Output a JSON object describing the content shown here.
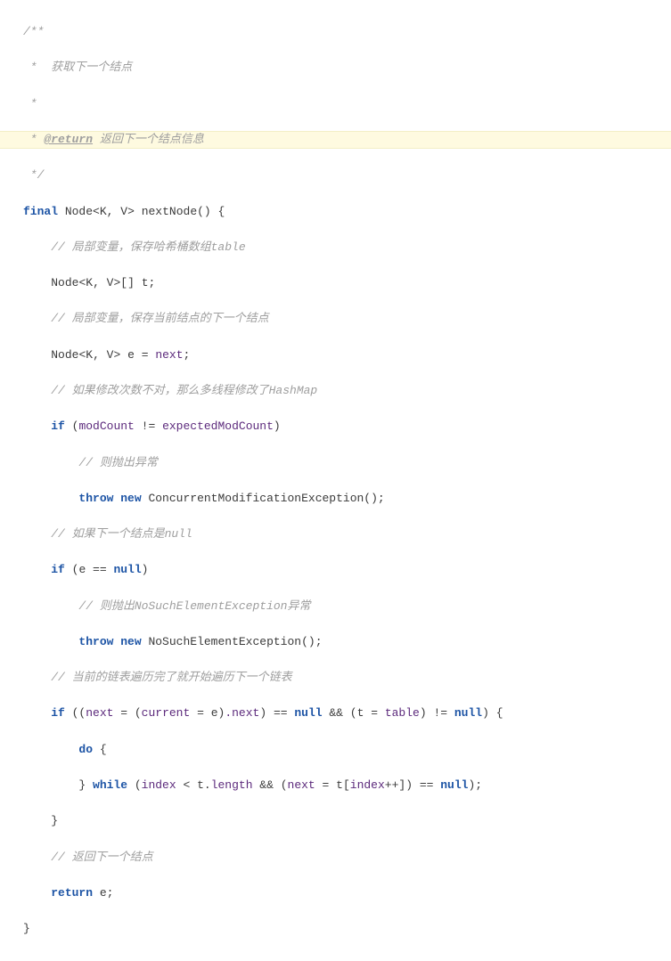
{
  "code": {
    "doc": {
      "open": "/**",
      "l1": " *  获取下一个结点",
      "l2": " *",
      "l3_prefix": " * ",
      "l3_tag": "@return",
      "l3_rest": " 返回下一个结点信息",
      "close": " */"
    },
    "sig": {
      "kw_final": "final",
      "type_node": "Node",
      "lt": "<",
      "kparam": "K",
      "comma": ", ",
      "vparam": "V",
      "gt": ">",
      "fn_name": " nextNode",
      "parens": "()",
      "brace": " {"
    },
    "l_localvar_t_cmt": "// 局部变量，保存哈希桶数组table",
    "l_decl_t": {
      "type_node": "Node",
      "lt": "<",
      "kparam": "K",
      "comma": ", ",
      "vparam": "V",
      "gt": ">",
      "arr": "[]",
      "var": " t",
      "semi": ";"
    },
    "l_localvar_e_cmt": "// 局部变量，保存当前结点的下一个结点",
    "l_decl_e": {
      "type_node": "Node",
      "lt": "<",
      "kparam": "K",
      "comma": ", ",
      "vparam": "V",
      "gt": ">",
      "var": " e ",
      "eq": "=",
      "rhs": " next",
      "semi": ";"
    },
    "l_modcount_cmt": "// 如果修改次数不对，那么多线程修改了HashMap",
    "l_if_modcount": {
      "kw_if": "if",
      "open": " (",
      "lhs": "modCount",
      "op": " != ",
      "rhs": "expectedModCount",
      "close": ")"
    },
    "l_throw_cme_cmt": "// 则抛出异常",
    "l_throw_cme": {
      "kw_throw": "throw",
      "kw_new": " new",
      "cls": " ConcurrentModificationException",
      "tail": "();"
    },
    "l_next_null_cmt": "// 如果下一个结点是null",
    "l_if_e_null": {
      "kw_if": "if",
      "open": " (",
      "lhs": "e ",
      "eq": "==",
      "rhs": " null",
      "close": ")"
    },
    "l_throw_nse_cmt": "// 则抛出NoSuchElementException异常",
    "l_throw_nse": {
      "kw_throw": "throw",
      "kw_new": " new",
      "cls": " NoSuchElementException",
      "tail": "();"
    },
    "l_curlist_cmt": "// 当前的链表遍历完了就开始遍历下一个链表",
    "l_if_next": {
      "kw_if": "if",
      "open1": " ((",
      "next": "next",
      "eq1": " = ",
      "open2": "(",
      "current": "current",
      "eq2": " = ",
      "e": "e",
      "close2": ")",
      "dotnext": ".next",
      "close1": ")",
      "eqeq": " == ",
      "null1": "null",
      "and1": " && ",
      "open3": "(",
      "t": "t ",
      "eq3": "= ",
      "table": "table",
      "close3": ")",
      "neq": " != ",
      "null2": "null",
      "close_outer": ")",
      "brace": " {"
    },
    "l_do": {
      "kw_do": "do",
      "brace": " {"
    },
    "l_while": {
      "close_brace": "} ",
      "kw_while": "while",
      "open": " (",
      "index1": "index",
      "lt": " < ",
      "tdot": "t.",
      "length": "length",
      "and": " && ",
      "open2": "(",
      "next": "next",
      "eq": " = ",
      "t": "t",
      "br_open": "[",
      "index2": "index",
      "inc": "++",
      "br_close": "]",
      "close2": ")",
      "eqeq": " == ",
      "null": "null",
      "close": ");"
    },
    "l_close_brace": "}",
    "l_return_cmt": "// 返回下一个结点",
    "l_return": {
      "kw_return": "return",
      "var": " e",
      "semi": ";"
    },
    "l_fn_close": "}"
  }
}
